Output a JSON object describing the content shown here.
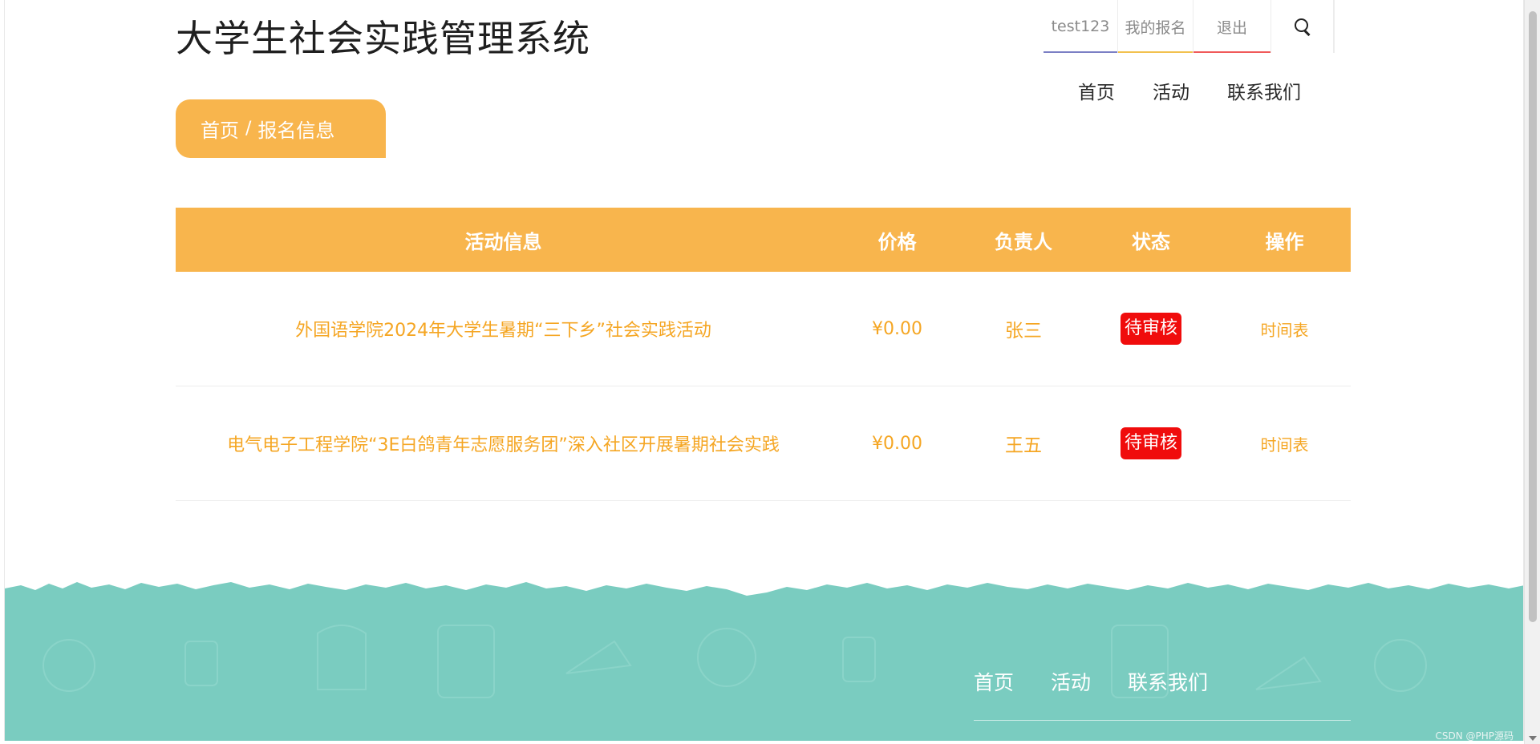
{
  "header": {
    "site_title": "大学生社会实践管理系统",
    "topbar": {
      "username": "test123",
      "my_registrations": "我的报名",
      "logout": "退出"
    },
    "nav": [
      "首页",
      "活动",
      "联系我们"
    ]
  },
  "breadcrumb": {
    "home": "首页",
    "separator": "/",
    "current": "报名信息"
  },
  "table": {
    "headers": {
      "info": "活动信息",
      "price": "价格",
      "owner": "负责人",
      "status": "状态",
      "op": "操作"
    },
    "rows": [
      {
        "info": "外国语学院2024年大学生暑期“三下乡”社会实践活动",
        "price": "¥0.00",
        "owner": "张三",
        "status": "待审核",
        "op": "时间表"
      },
      {
        "info": "电气电子工程学院“3E白鸽青年志愿服务团”深入社区开展暑期社会实践",
        "price": "¥0.00",
        "owner": "王五",
        "status": "待审核",
        "op": "时间表"
      }
    ]
  },
  "footer": {
    "nav": [
      "首页",
      "活动",
      "联系我们"
    ],
    "watermark": "CSDN @PHP源码"
  },
  "colors": {
    "accent": "#f8b54d",
    "link": "#f5a623",
    "status_pending": "#f00c0c",
    "footer_bg": "#7accc0",
    "underline_user": "#7b7fc4",
    "underline_reg": "#f2c14e",
    "underline_logout": "#f05a5a"
  },
  "icons": {
    "search": "search-icon"
  }
}
